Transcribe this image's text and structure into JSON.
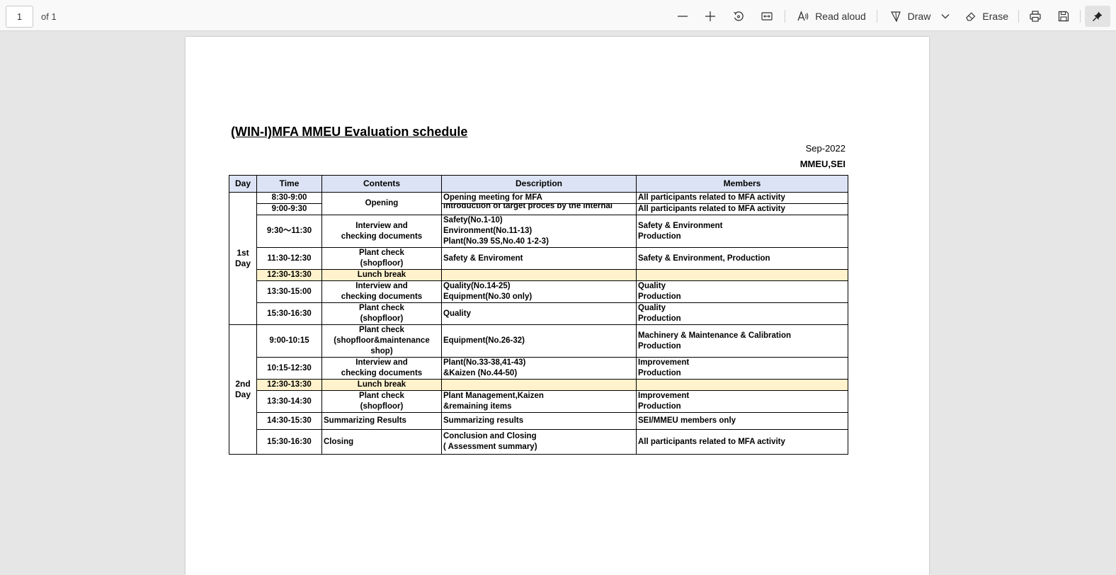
{
  "toolbar": {
    "page_number": "1",
    "page_count": "of 1",
    "read_aloud_label": "Read aloud",
    "draw_label": "Draw",
    "erase_label": "Erase"
  },
  "document": {
    "title": "(WIN-I)MFA MMEU Evaluation schedule",
    "date": "Sep-2022",
    "org": "MMEU,SEI",
    "columns": [
      "Day",
      "Time",
      "Contents",
      "Description",
      "Members"
    ],
    "day1": "1st\nDay",
    "day2": "2nd\nDay",
    "rows": [
      {
        "time": "8:30-9:00",
        "contents": "Opening",
        "description": [
          "Opening meeting for MFA"
        ],
        "members": [
          "All participants related to MFA activity"
        ]
      },
      {
        "time": "9:00-9:30",
        "contents": "",
        "description": [
          "Introduction of target proces by the internal process"
        ],
        "members": [
          "All participants related to MFA activity"
        ]
      },
      {
        "time": "9:30〜11:30",
        "contents": "Interview and\nchecking documents",
        "description": [
          "Safety(No.1-10)",
          "Environment(No.11-13)",
          "Plant(No.39 5S,No.40 1-2-3)"
        ],
        "members": [
          "Safety & Environment",
          "Production"
        ]
      },
      {
        "time": "11:30-12:30",
        "contents": "Plant check\n(shopfloor)",
        "description": [
          "Safety & Enviroment"
        ],
        "members": [
          "Safety & Environment, Production"
        ]
      },
      {
        "time": "12:30-13:30",
        "contents": "Lunch break",
        "description": [],
        "members": []
      },
      {
        "time": "13:30-15:00",
        "contents": "Interview and\nchecking documents",
        "description": [
          "Quality(No.14-25)",
          "Equipment(No.30 only)"
        ],
        "members": [
          "Quality",
          "Production"
        ]
      },
      {
        "time": "15:30-16:30",
        "contents": "Plant check\n(shopfloor)",
        "description": [
          "Quality"
        ],
        "members": [
          "Quality",
          "Production"
        ]
      },
      {
        "time": "9:00-10:15",
        "contents": "Plant check\n(shopfloor&maintenance shop)",
        "description": [
          "Equipment(No.26-32)"
        ],
        "members": [
          "Machinery & Maintenance & Calibration",
          "Production"
        ]
      },
      {
        "time": "10:15-12:30",
        "contents": "Interview and\nchecking documents",
        "description": [
          "Plant(No.33-38,41-43)",
          "&Kaizen (No.44-50)"
        ],
        "members": [
          "Improvement",
          "Production"
        ]
      },
      {
        "time": "12:30-13:30",
        "contents": "Lunch break",
        "description": [],
        "members": []
      },
      {
        "time": "13:30-14:30",
        "contents": "Plant check\n(shopfloor)",
        "description": [
          "Plant Management,Kaizen",
          "&remaining items"
        ],
        "members": [
          "Improvement",
          "Production"
        ]
      },
      {
        "time": "14:30-15:30",
        "contents": "Summarizing Results",
        "description": [
          "Summarizing results"
        ],
        "members": [
          "SEI/MMEU members only"
        ]
      },
      {
        "time": "15:30-16:30",
        "contents": "Closing",
        "description": [
          "Conclusion and Closing",
          "( Assessment summary)"
        ],
        "members": [
          "All participants related to MFA activity"
        ]
      }
    ]
  },
  "colors": {
    "header_fill": "#dce3f4",
    "lunch_fill": "#fff2cc",
    "viewer_background": "#e6e6e6"
  },
  "icons": [
    "zoom-out-icon",
    "zoom-in-icon",
    "rotate-icon",
    "fit-page-icon",
    "read-aloud-icon",
    "draw-icon",
    "chevron-down-icon",
    "erase-icon",
    "print-icon",
    "save-icon",
    "pin-icon"
  ]
}
